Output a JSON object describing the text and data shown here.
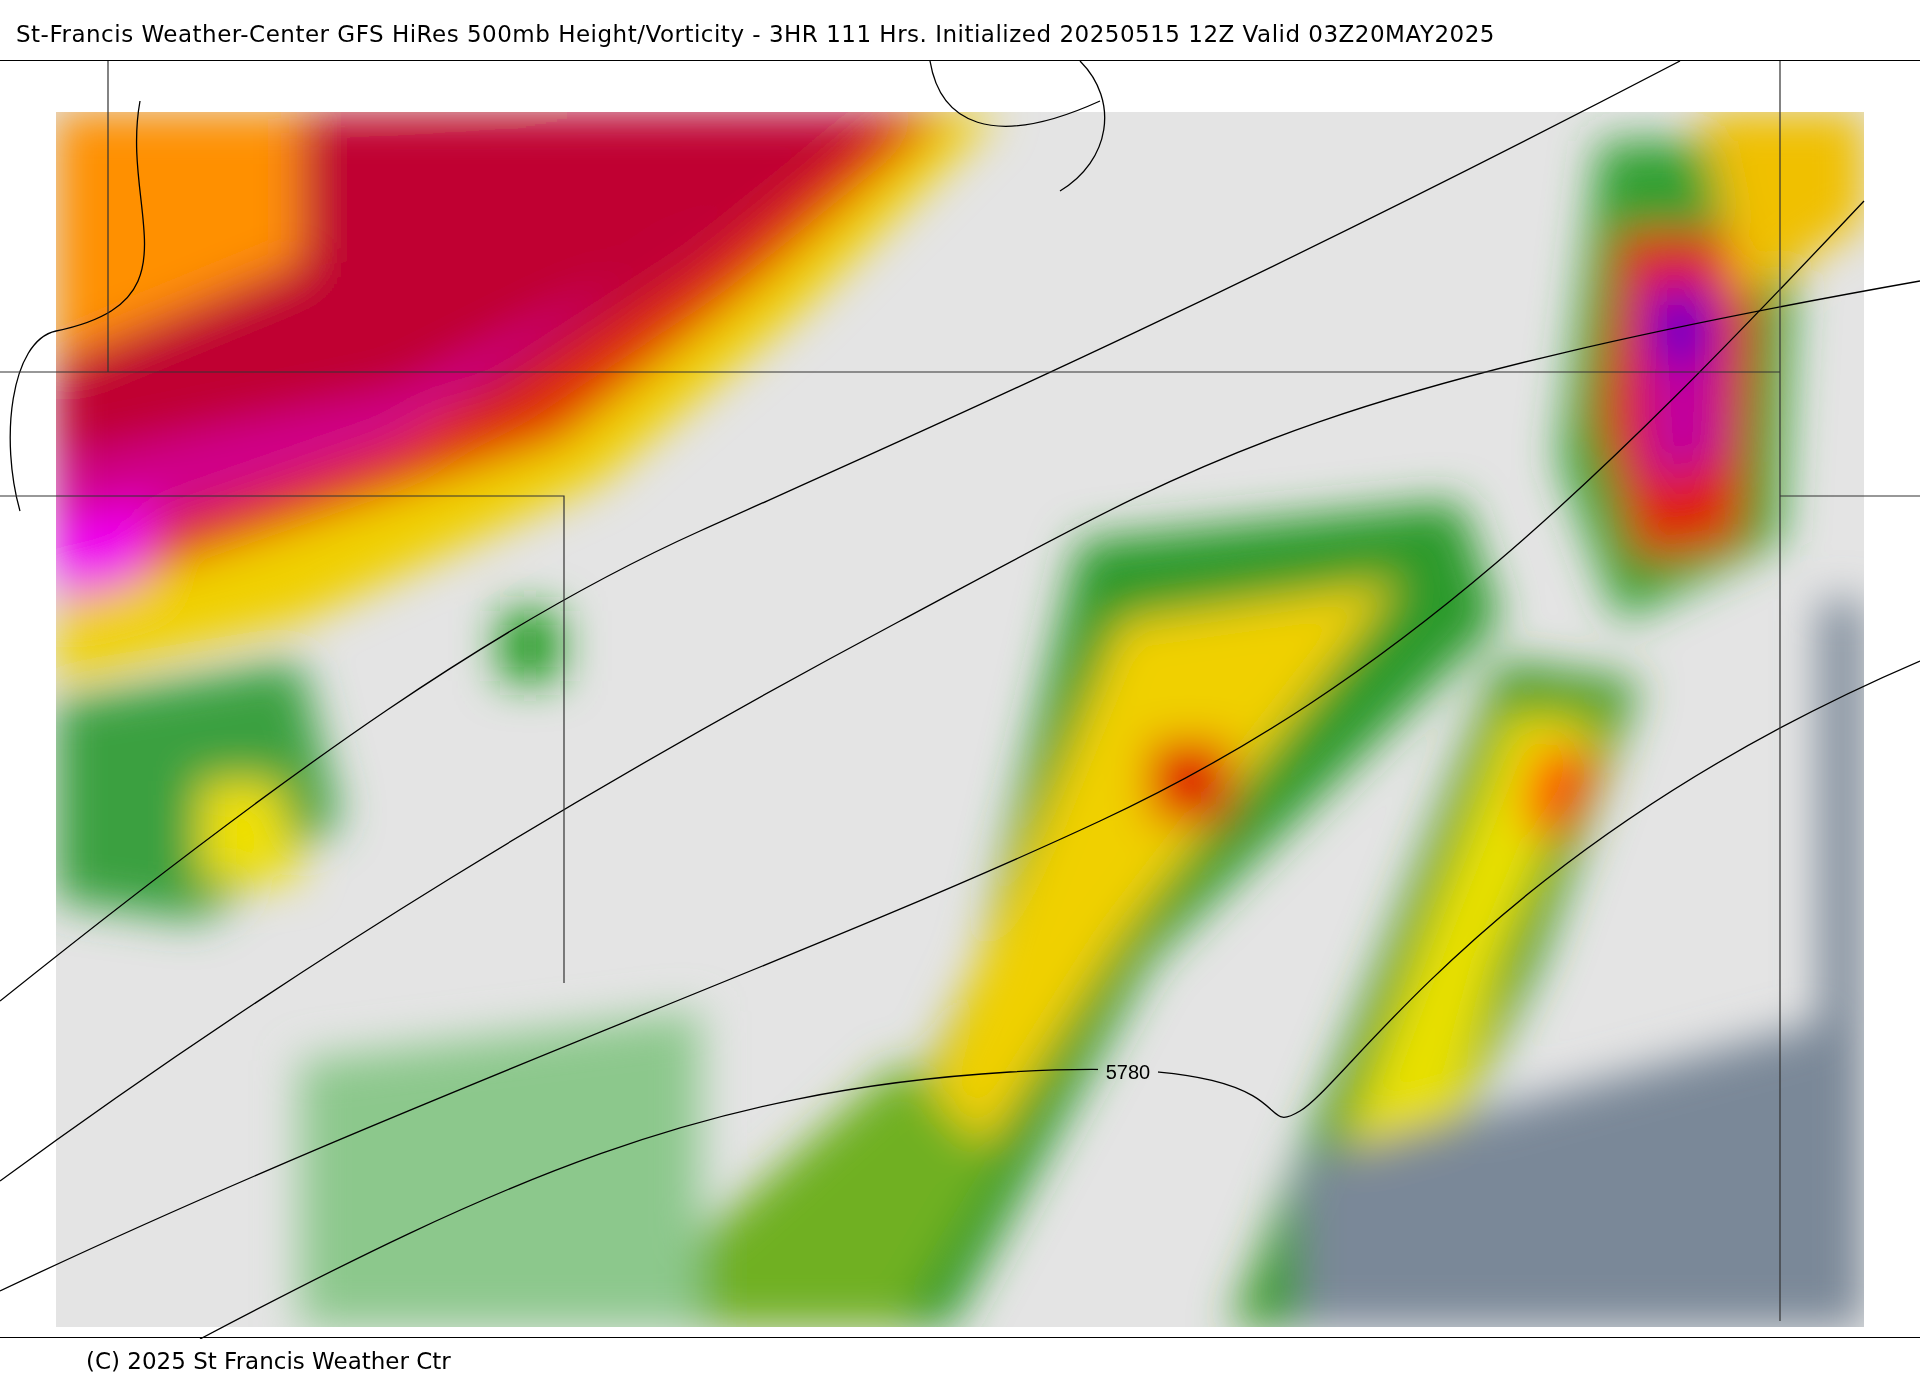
{
  "title": "St-Francis Weather-Center GFS HiRes 500mb Height/Vorticity - 3HR  111 Hrs.  Initialized 20250515 12Z Valid 03Z20MAY2025",
  "map": {
    "contour_labels": [
      "5780"
    ]
  },
  "footer": "(C) 2025 St Francis Weather Ctr"
}
